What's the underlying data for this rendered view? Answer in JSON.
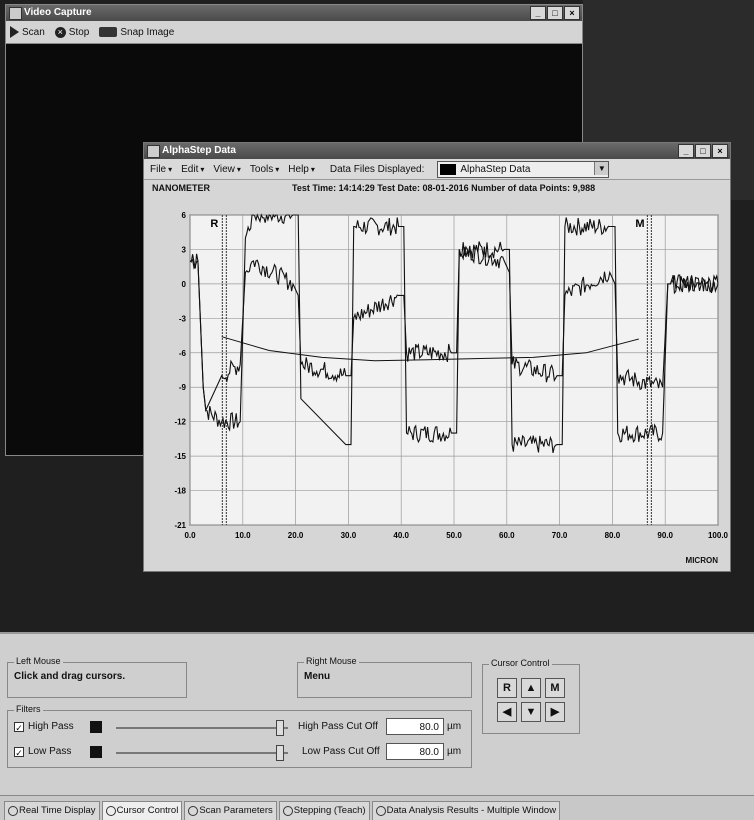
{
  "video_capture": {
    "title": "Video Capture",
    "toolbar": {
      "scan_label": "Scan",
      "stop_label": "Stop",
      "snap_label": "Snap Image"
    }
  },
  "alphastep": {
    "title": "AlphaStep Data",
    "menu": [
      {
        "label": "File"
      },
      {
        "label": "Edit"
      },
      {
        "label": "View"
      },
      {
        "label": "Tools"
      },
      {
        "label": "Help"
      }
    ],
    "data_files_label": "Data Files Displayed:",
    "data_files_value": "AlphaStep Data",
    "unit_label": "NANOMETER",
    "header_text": "Test Time: 14:14:29  Test Date: 08-01-2016  Number of data Points: 9,988"
  },
  "chart_data": {
    "type": "line",
    "xlabel": "MICRON",
    "ylabel": "NANOMETER",
    "xlim": [
      0,
      100
    ],
    "ylim": [
      -21,
      6
    ],
    "x_ticks": [
      "0.0",
      "10.0",
      "20.0",
      "30.0",
      "40.0",
      "50.0",
      "60.0",
      "70.0",
      "80.0",
      "90.0",
      "100.0"
    ],
    "y_ticks": [
      "6",
      "3",
      "0",
      "-3",
      "-6",
      "-9",
      "-12",
      "-15",
      "-18",
      "-21"
    ],
    "grid": true,
    "cursors": [
      {
        "label": "R",
        "x": 6.5
      },
      {
        "label": "M",
        "x": 87
      }
    ],
    "series": [
      {
        "x": [
          0,
          1.5,
          2.5,
          3,
          6,
          9.5,
          10.5,
          12,
          19.5,
          20.5,
          21,
          29.5,
          30.5,
          31,
          39.5,
          40.5,
          41,
          49.5,
          50.5,
          51,
          59.5,
          60.5,
          61,
          69.5,
          70.5,
          71,
          79.5,
          80.5,
          81,
          89.5,
          90.5,
          91,
          100
        ],
        "y": [
          2,
          2,
          -9,
          -11,
          -12,
          -12,
          4,
          6,
          6,
          6,
          -10,
          -14,
          -14,
          5,
          5,
          5,
          -13,
          -13,
          -13,
          3,
          3,
          3,
          -14,
          -14,
          -14,
          5,
          5,
          5,
          -13,
          -13,
          0,
          0,
          0
        ]
      },
      {
        "x": [
          0,
          1.5,
          2.5,
          3,
          6,
          9.5,
          10.5,
          12,
          19.5,
          20.5,
          21,
          29.5,
          30.5,
          31,
          39.5,
          40.5,
          41,
          49.5,
          50.5,
          51,
          59.5,
          60.5,
          61,
          69.5,
          70.5,
          71,
          79.5,
          80.5,
          81,
          89.5,
          90.5,
          91,
          100
        ],
        "y": [
          2,
          2,
          -9,
          -11,
          -8,
          -7,
          1,
          2,
          0,
          -1,
          -7,
          -8,
          -8,
          -3,
          -1,
          -1,
          -6,
          -6,
          -6,
          3,
          2,
          1,
          -7,
          -8,
          -8,
          -1,
          1,
          0,
          -8,
          -9,
          0,
          0,
          0
        ]
      },
      {
        "x": [
          6,
          15,
          25,
          35,
          45,
          55,
          65,
          75,
          85
        ],
        "y": [
          -4.6,
          -5.8,
          -6.4,
          -6.7,
          -6.6,
          -6.5,
          -6.4,
          -6.0,
          -4.8
        ]
      }
    ]
  },
  "panel": {
    "left_mouse": {
      "title": "Left Mouse",
      "text": "Click and drag cursors."
    },
    "right_mouse": {
      "title": "Right Mouse",
      "text": "Menu"
    },
    "cursor_control": {
      "title": "Cursor Control",
      "r_label": "R",
      "m_label": "M"
    },
    "filters": {
      "title": "Filters",
      "high_pass_label": "High Pass",
      "low_pass_label": "Low Pass",
      "high_cutoff_label": "High Pass Cut Off",
      "low_cutoff_label": "Low Pass Cut Off",
      "high_cutoff_value": "80.0",
      "low_cutoff_value": "80.0",
      "unit": "µm",
      "high_checked": "✓",
      "low_checked": "✓",
      "high_slider_level": 0.95,
      "low_slider_level": 0.95
    }
  },
  "tabs": [
    {
      "label": "Real Time Display"
    },
    {
      "label": "Cursor Control"
    },
    {
      "label": "Scan Parameters"
    },
    {
      "label": "Stepping (Teach)"
    },
    {
      "label": "Data Analysis Results - Multiple Window"
    }
  ],
  "colors": {
    "plot_bg": "#f2f2f2",
    "trace": "#111111",
    "grid": "#9a9a9a"
  }
}
